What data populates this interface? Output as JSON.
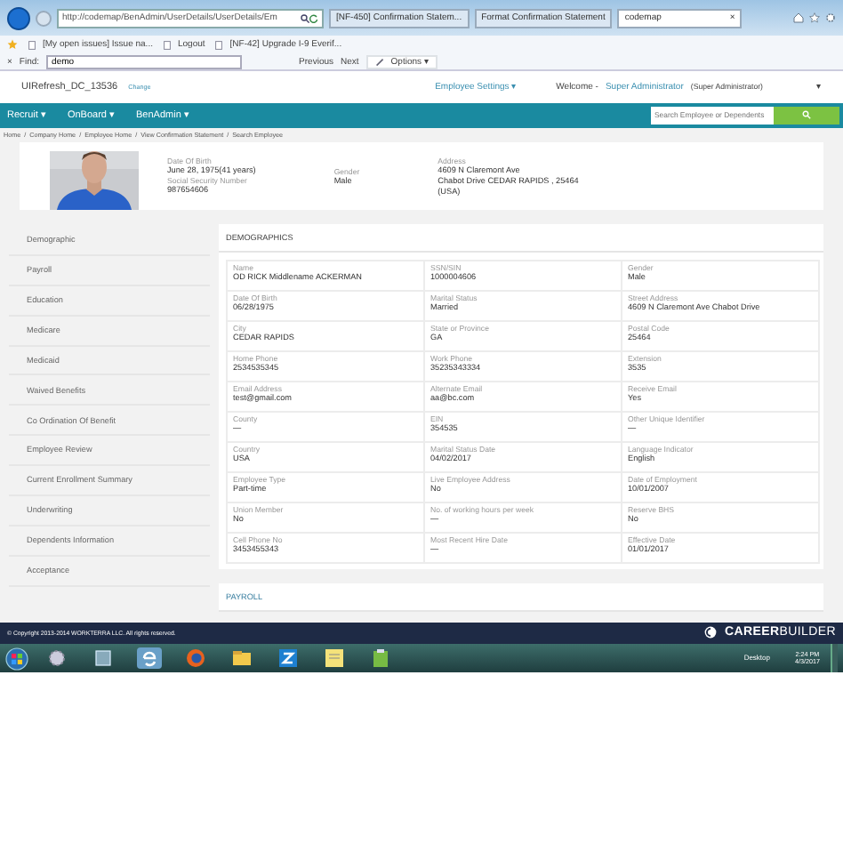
{
  "browser": {
    "address": "http://codemap/BenAdmin/UserDetails/UserDetails/Em",
    "tabs": [
      {
        "label": "[NF-450] Confirmation Statem...",
        "selected": false
      },
      {
        "label": "Format Confirmation Statement",
        "selected": false
      },
      {
        "label": "codemap",
        "selected": true
      }
    ],
    "close_tab": "×",
    "favorites": [
      "[My open issues] Issue na...",
      "Logout",
      "[NF-42] Upgrade I-9 Everif..."
    ],
    "find_bar": {
      "close": "×",
      "label": "Find:",
      "value": "demo",
      "buttons": [
        "Previous",
        "Next"
      ],
      "options": "Options ▾"
    }
  },
  "header": {
    "site": "UIRefresh_DC_13536",
    "change": "Change",
    "settings": "Employee Settings ▾",
    "welcome": "Welcome -",
    "user": "Super Administrator",
    "role": "(Super Administrator)",
    "caret": "▾"
  },
  "nav": {
    "menus": [
      "Recruit ▾",
      "OnBoard ▾",
      "BenAdmin ▾"
    ],
    "search": {
      "placeholder": "Search Employee or Dependents"
    }
  },
  "breadcrumb": {
    "separator": "/",
    "items": [
      "Home",
      "Company Home",
      "Employee Home",
      "View Confirmation Statement",
      "Search Employee"
    ]
  },
  "profile": {
    "photo": {
      "kind": "picture"
    },
    "columns": [
      [
        {
          "label": "Date Of Birth",
          "lines": [
            "June 28, 1975(41 years)"
          ]
        },
        {
          "label": "Social Security Number",
          "lines": [
            "987654606"
          ]
        }
      ],
      [
        {
          "label": "Gender",
          "lines": [
            "Male"
          ]
        }
      ],
      [
        {
          "label": "Address",
          "lines": [
            "4609 N Claremont Ave",
            "Chabot Drive CEDAR RAPIDS , 25464",
            "(USA)"
          ]
        }
      ]
    ]
  },
  "sidebar": {
    "items": [
      {
        "label": "Demographic",
        "selected": false
      },
      {
        "label": "Payroll",
        "selected": false
      },
      {
        "label": "Education",
        "selected": false
      },
      {
        "label": "Medicare",
        "selected": false
      },
      {
        "label": "Medicaid",
        "selected": false
      },
      {
        "label": "Waived Benefits",
        "selected": false
      },
      {
        "label": "Co Ordination Of Benefit",
        "selected": false
      },
      {
        "label": "Employee Review",
        "selected": false
      },
      {
        "label": "Current Enrollment Summary",
        "selected": false
      },
      {
        "label": "Underwriting",
        "selected": false
      },
      {
        "label": "Dependents Information",
        "selected": false
      },
      {
        "label": "Acceptance",
        "selected": false
      }
    ]
  },
  "demographics": {
    "title": "DEMOGRAPHICS",
    "fields": [
      {
        "label": "Name",
        "value": "OD RICK Middlename ACKERMAN"
      },
      {
        "label": "SSN/SIN",
        "value": "1000004606"
      },
      {
        "label": "Gender",
        "value": "Male"
      },
      {
        "label": "Date Of Birth",
        "value": "06/28/1975"
      },
      {
        "label": "Marital Status",
        "value": "Married"
      },
      {
        "label": "Street Address",
        "value": "4609 N Claremont Ave Chabot Drive"
      },
      {
        "label": "City",
        "value": "CEDAR RAPIDS"
      },
      {
        "label": "State or Province",
        "value": "GA"
      },
      {
        "label": "Postal Code",
        "value": "25464"
      },
      {
        "label": "Home Phone",
        "value": "2534535345"
      },
      {
        "label": "Work Phone",
        "value": "35235343334"
      },
      {
        "label": "Extension",
        "value": "3535"
      },
      {
        "label": "Email Address",
        "value": "test@gmail.com"
      },
      {
        "label": "Alternate Email",
        "value": "aa@bc.com"
      },
      {
        "label": "Receive Email",
        "value": "Yes"
      },
      {
        "label": "County",
        "value": "—"
      },
      {
        "label": "EIN",
        "value": "354535"
      },
      {
        "label": "Other Unique Identifier",
        "value": "—"
      },
      {
        "label": "Country",
        "value": "USA"
      },
      {
        "label": "Marital Status Date",
        "value": "04/02/2017"
      },
      {
        "label": "Language Indicator",
        "value": "English"
      },
      {
        "label": "Employee Type",
        "value": "Part-time"
      },
      {
        "label": "Live Employee Address",
        "value": "No"
      },
      {
        "label": "Date of Employment",
        "value": "10/01/2007"
      },
      {
        "label": "Union Member",
        "value": "No"
      },
      {
        "label": "No. of working hours per week",
        "value": "—"
      },
      {
        "label": "Reserve BHS",
        "value": "No"
      },
      {
        "label": "Cell Phone No",
        "value": "3453455343"
      },
      {
        "label": "Most Recent Hire Date",
        "value": "—"
      },
      {
        "label": "Effective Date",
        "value": "01/01/2017"
      }
    ]
  },
  "payroll": {
    "title": "PAYROLL"
  },
  "footer": {
    "copyright": "© Copyright 2013-2014 WORKTERRA LLC. All rights reserved.",
    "logo": "**CAREER**BUILDER"
  },
  "taskbar": {
    "desktop": "Desktop",
    "time": "2:24 PM",
    "date": "4/3/2017"
  }
}
